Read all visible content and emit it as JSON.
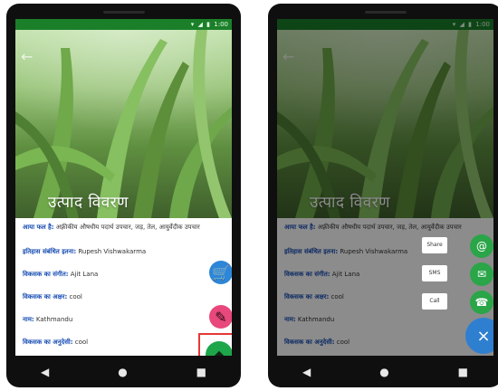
{
  "left": {
    "hero_title": "उत्पाद विवरण",
    "rows": [
      {
        "k": "आया फल है:",
        "v": " अफ़्रीकीय औषधीय पदार्थ उपचार, जड़, तेल, आयुर्वेदीक उपचार"
      },
      {
        "k": "इतिहास संबंधित इतना:",
        "v": " Rupesh Vishwakarma"
      },
      {
        "k": "विकसक का संगीत:",
        "v": " Ajit Lana"
      },
      {
        "k": "विकसक का अक्षर:",
        "v": " cool"
      },
      {
        "k": "नाम:",
        "v": " Kathmandu"
      },
      {
        "k": "विकसक का अनुदेसी:",
        "v": " cool"
      }
    ],
    "nav": {
      "back": "◀",
      "home": "●",
      "recent": "■"
    }
  },
  "right": {
    "hero_title": "उत्पाद विवरण",
    "chips": [
      {
        "label": "Share"
      },
      {
        "label": "SMS"
      },
      {
        "label": "Call"
      }
    ],
    "minis": [
      {
        "icon": "email-icon",
        "glyph": "@"
      },
      {
        "icon": "message-icon",
        "glyph": "✉"
      },
      {
        "icon": "phone-icon",
        "glyph": "☎"
      }
    ],
    "close_glyph": "×",
    "nav": {
      "back": "◀",
      "home": "●",
      "recent": "■"
    }
  },
  "colors": {
    "statusbar": "#1b7f2a",
    "cart_fab": "#2d86d8",
    "edit_fab": "#e8487c",
    "main_fab": "#1ea64b",
    "close_fab": "#2f7fd0",
    "highlight": "#e53935"
  }
}
